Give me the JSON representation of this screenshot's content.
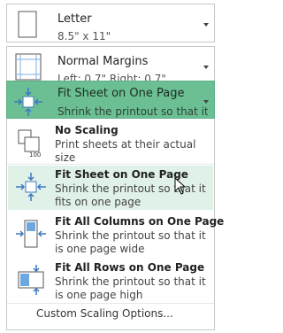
{
  "size": {
    "title": "Letter",
    "subtitle": "8.5\" x 11\"",
    "icon": "paper-icon"
  },
  "margins": {
    "title": "Normal Margins",
    "subtitle": "Left:  0.7\"    Right:  0.7\"",
    "icon": "margins-icon"
  },
  "scaling": {
    "title": "Fit Sheet on One Page",
    "subtitle": "Shrink the printout so that it ...",
    "icon": "fit-sheet-icon",
    "accent": "#6bbf93"
  },
  "menu": {
    "options": [
      {
        "title": "No Scaling",
        "desc": "Print sheets at their actual size",
        "icon": "no-scaling-icon",
        "badge": "100"
      },
      {
        "title": "Fit Sheet on One Page",
        "desc": "Shrink the printout so that it fits on one page",
        "icon": "fit-sheet-icon"
      },
      {
        "title": "Fit All Columns on One Page",
        "desc": "Shrink the printout so that it is one page wide",
        "icon": "fit-columns-icon"
      },
      {
        "title": "Fit All Rows on One Page",
        "desc": "Shrink the printout so that it is one page high",
        "icon": "fit-rows-icon"
      }
    ],
    "custom_label": "Custom Scaling Options...",
    "highlight": "#e0f1e7"
  }
}
